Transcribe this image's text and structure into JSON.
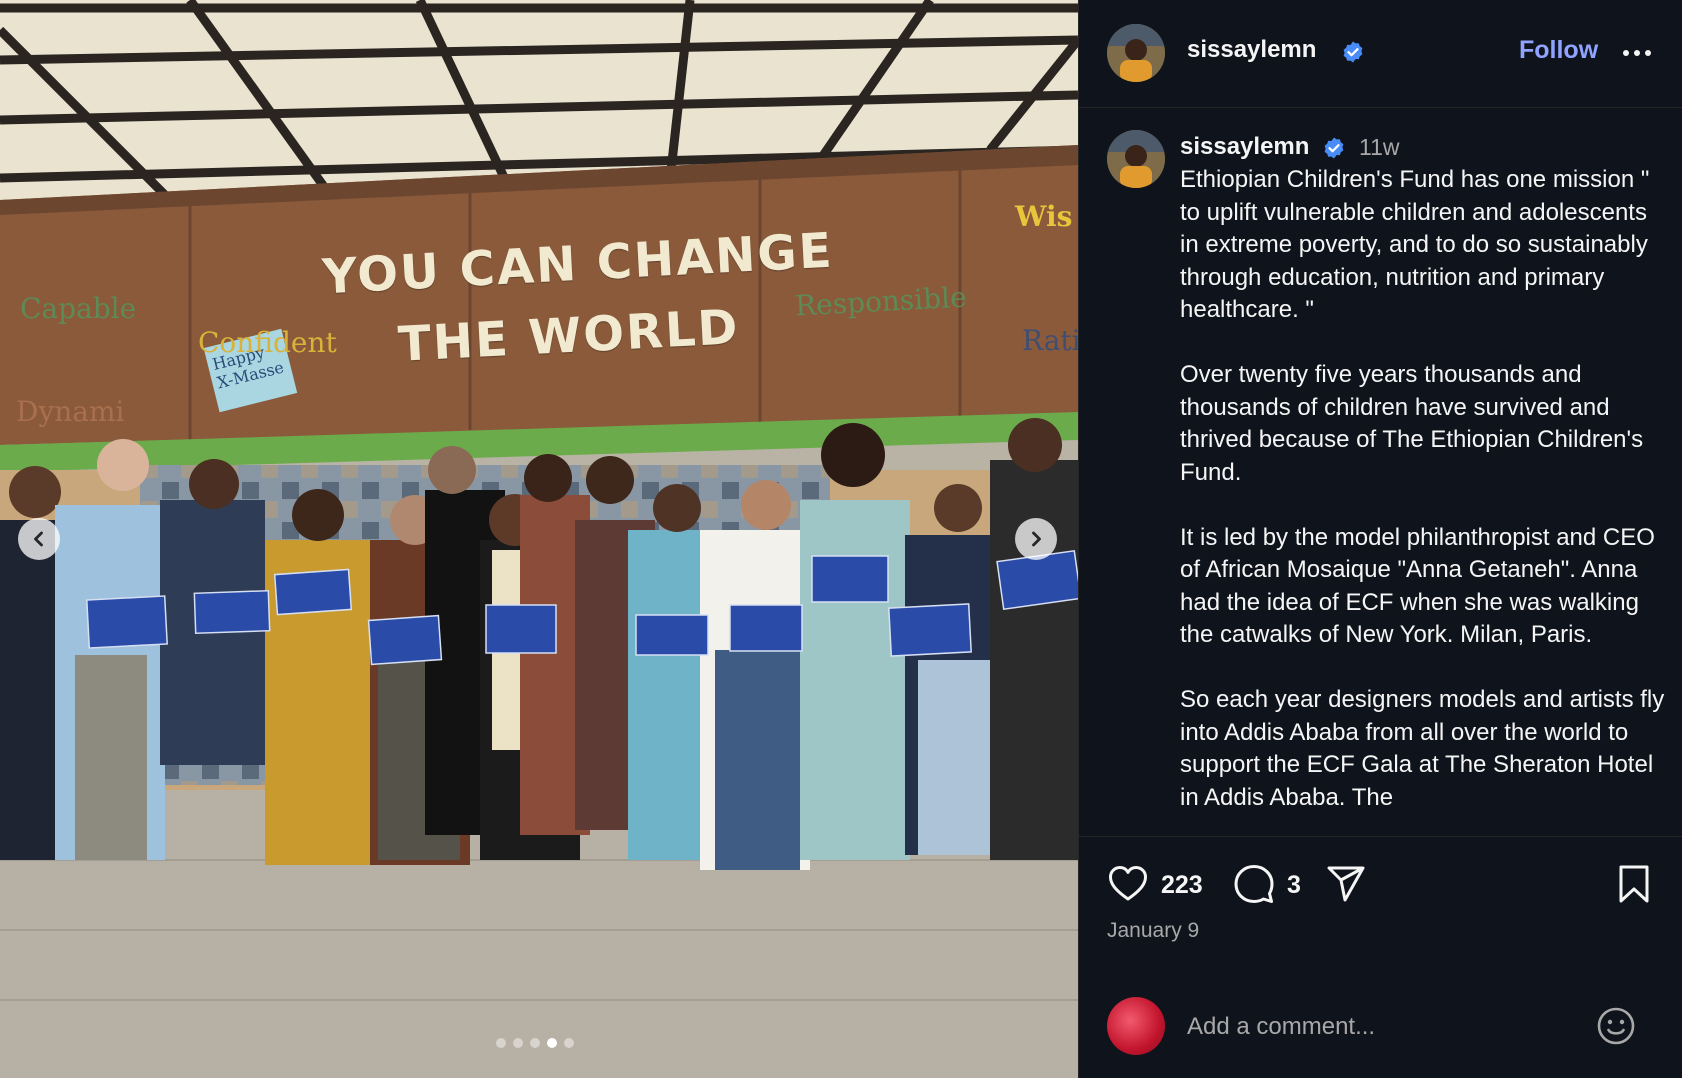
{
  "media": {
    "wall_line1": "YOU CAN CHANGE",
    "wall_line2": "THE WORLD",
    "wall_words": [
      "Capable",
      "Confident",
      "Responsible",
      "Wis",
      "Ratio",
      "Dynami"
    ],
    "sticky_note": "Happy X-Masse",
    "carousel": {
      "slide_count": 5,
      "active_index": 3
    }
  },
  "header": {
    "username": "sissaylemn",
    "follow_label": "Follow"
  },
  "caption": {
    "username": "sissaylemn",
    "time_ago": "11w",
    "paragraphs": [
      "Ethiopian Children's Fund has one mission \" to uplift vulnerable children and adolescents in extreme poverty, and to do so sustainably through education, nutrition and primary healthcare. \"",
      "Over twenty five years thousands and thousands of children have survived and thrived because of The Ethiopian Children's Fund.",
      "It is led by the model philanthropist and CEO of African Mosaique \"Anna Getaneh\". Anna had the idea of ECF when she was walking the catwalks of New York. Milan, Paris.",
      "So each year designers models and artists fly into Addis Ababa from all over the world to support the ECF Gala at The Sheraton Hotel in Addis Ababa. The"
    ]
  },
  "actions": {
    "like_count": "223",
    "comment_count": "3",
    "date": "January 9",
    "comment_placeholder": "Add a comment..."
  },
  "colors": {
    "panel_bg": "#0f141c",
    "follow": "#8fa3ff",
    "verified": "#4a8cf7",
    "muted_text": "#a8a8a8"
  },
  "icons": [
    "chevron-left-icon",
    "chevron-right-icon",
    "verified-badge-icon",
    "more-icon",
    "heart-icon",
    "comment-icon",
    "share-icon",
    "bookmark-icon",
    "emoji-icon"
  ]
}
